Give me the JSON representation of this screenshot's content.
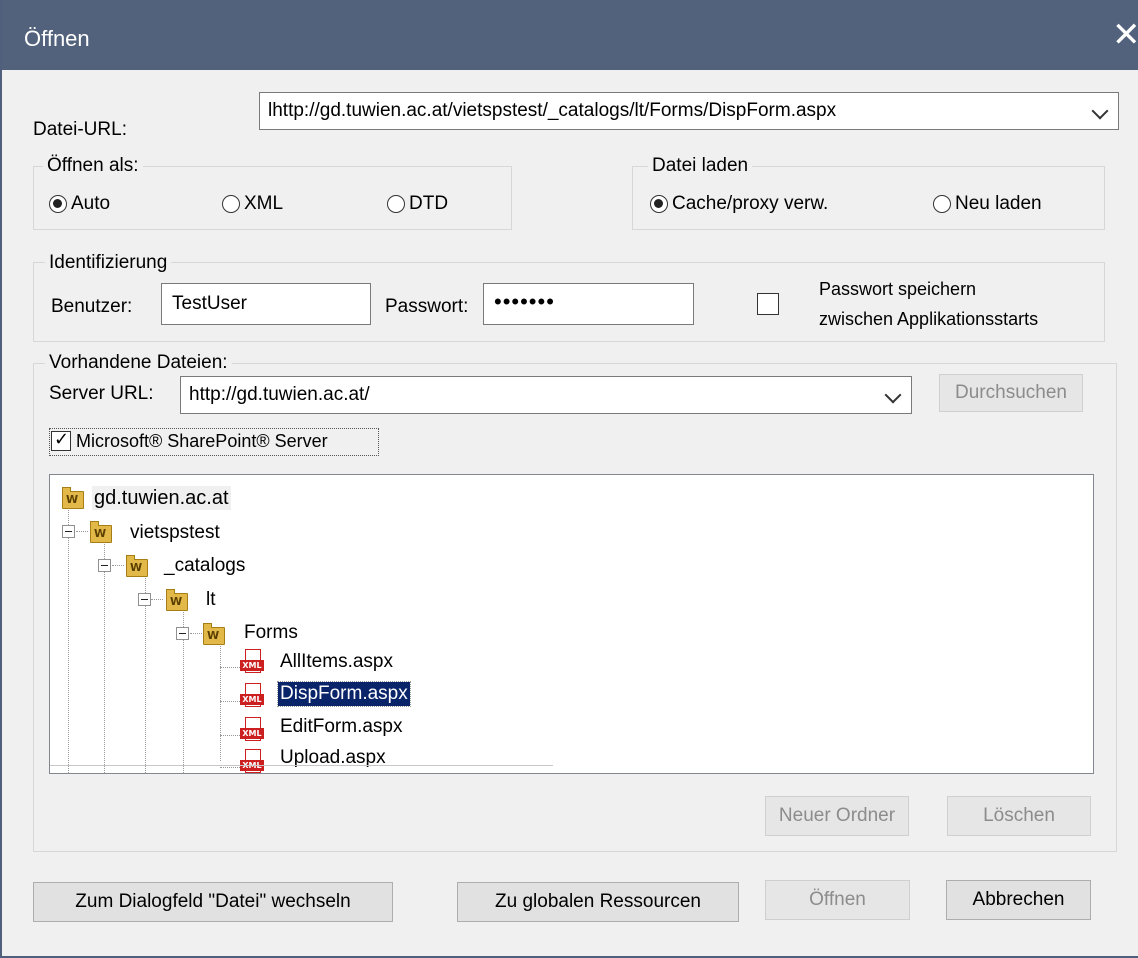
{
  "window": {
    "title": "Öffnen",
    "close_glyph": "✕"
  },
  "file_url": {
    "label": "Datei-URL:",
    "value": "lhttp://gd.tuwien.ac.at/vietspstest/_catalogs/lt/Forms/DispForm.aspx"
  },
  "open_as": {
    "legend": "Öffnen als:",
    "options": [
      "Auto",
      "XML",
      "DTD"
    ],
    "selected": "Auto"
  },
  "load_file": {
    "legend": "Datei laden",
    "options": [
      "Cache/proxy verw.",
      "Neu laden"
    ],
    "selected": "Cache/proxy verw."
  },
  "identification": {
    "legend": "Identifizierung",
    "user_label": "Benutzer:",
    "user_value": "TestUser",
    "password_label": "Passwort:",
    "password_value": "•••••••",
    "save_password_label_line1": "Passwort speichern",
    "save_password_label_line2": "zwischen Applikationsstarts",
    "save_password_checked": false
  },
  "existing_files": {
    "legend": "Vorhandene Dateien:",
    "server_url_label": "Server URL:",
    "server_url_value": "http://gd.tuwien.ac.at/",
    "browse_label": "Durchsuchen",
    "sharepoint_label": "Microsoft® SharePoint® Server",
    "sharepoint_checked": true,
    "tree": {
      "root": "gd.tuwien.ac.at",
      "folders": [
        "vietspstest",
        "_catalogs",
        "lt",
        "Forms"
      ],
      "files": [
        "AllItems.aspx",
        "DispForm.aspx",
        "EditForm.aspx",
        "Upload.aspx"
      ],
      "selected_file": "DispForm.aspx",
      "folder_badge": "W",
      "file_badge": "XML"
    },
    "new_folder_label": "Neuer Ordner",
    "delete_label": "Löschen"
  },
  "footer": {
    "switch_dialog_label": "Zum Dialogfeld \"Datei\" wechseln",
    "global_resources_label": "Zu globalen Ressourcen",
    "open_label": "Öffnen",
    "cancel_label": "Abbrechen"
  }
}
